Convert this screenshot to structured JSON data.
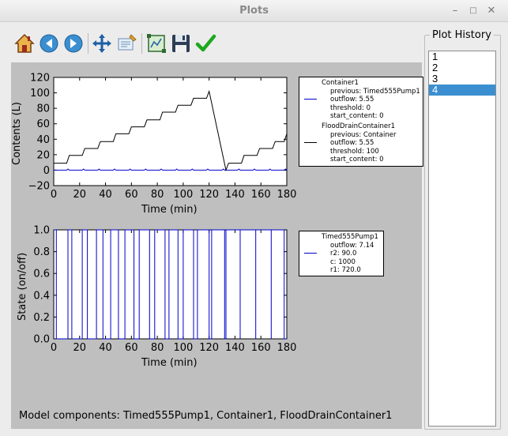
{
  "window": {
    "title": "Plots"
  },
  "toolbar": {
    "buttons": [
      {
        "icon": "home-icon",
        "name": "home-button"
      },
      {
        "icon": "back-arrow-icon",
        "name": "back-button"
      },
      {
        "icon": "forward-arrow-icon",
        "name": "forward-button"
      },
      {
        "icon": "pan-move-icon",
        "name": "pan-button"
      },
      {
        "icon": "zoom-icon",
        "name": "zoom-button"
      },
      {
        "icon": "subplots-config-icon",
        "name": "configure-subplots-button"
      },
      {
        "icon": "save-disk-icon",
        "name": "save-button"
      },
      {
        "icon": "checkmark-icon",
        "name": "apply-button"
      }
    ]
  },
  "chart_data": [
    {
      "type": "line",
      "xlabel": "Time (min)",
      "ylabel": "Contents (L)",
      "xlim": [
        0,
        180
      ],
      "ylim": [
        -20,
        120
      ],
      "xticks": [
        "0",
        "20",
        "40",
        "60",
        "80",
        "100",
        "120",
        "140",
        "160",
        "180"
      ],
      "yticks": [
        "−20",
        "0",
        "20",
        "40",
        "60",
        "80",
        "100",
        "120"
      ],
      "legend_placement": "outside-right",
      "series": [
        {
          "name": "Container1",
          "color": "#0000cc",
          "legend_lines": [
            "previous: Timed555Pump1",
            "outflow: 5.55",
            "threshold: 0",
            "start_content: 0"
          ],
          "points": [
            [
              0,
              0
            ],
            [
              10,
              0
            ],
            [
              11,
              1.5
            ],
            [
              12,
              0
            ],
            [
              22,
              0
            ],
            [
              23,
              1.5
            ],
            [
              24,
              0
            ],
            [
              34,
              0
            ],
            [
              35,
              1.5
            ],
            [
              36,
              0
            ],
            [
              46,
              0
            ],
            [
              47,
              1.5
            ],
            [
              48,
              0
            ],
            [
              58,
              0
            ],
            [
              59,
              1.5
            ],
            [
              60,
              0
            ],
            [
              70,
              0
            ],
            [
              71,
              1.5
            ],
            [
              72,
              0
            ],
            [
              82,
              0
            ],
            [
              83,
              1.5
            ],
            [
              84,
              0
            ],
            [
              94,
              0
            ],
            [
              95,
              1.5
            ],
            [
              96,
              0
            ],
            [
              106,
              0
            ],
            [
              107,
              1.5
            ],
            [
              108,
              0
            ],
            [
              118,
              0
            ],
            [
              119,
              1.5
            ],
            [
              120,
              0
            ],
            [
              130,
              0
            ],
            [
              131,
              1.5
            ],
            [
              132,
              0
            ],
            [
              142,
              0
            ],
            [
              143,
              1.5
            ],
            [
              144,
              0
            ],
            [
              154,
              0
            ],
            [
              155,
              1.5
            ],
            [
              156,
              0
            ],
            [
              166,
              0
            ],
            [
              167,
              1.5
            ],
            [
              168,
              0
            ],
            [
              178,
              0
            ],
            [
              179,
              1.5
            ],
            [
              180,
              0
            ]
          ]
        },
        {
          "name": "FloodDrainContainer1",
          "color": "#000000",
          "legend_lines": [
            "previous: Container",
            "outflow: 5.55",
            "threshold: 100",
            "start_content: 0"
          ],
          "points": [
            [
              0,
              9
            ],
            [
              10,
              9
            ],
            [
              12,
              19
            ],
            [
              22,
              19
            ],
            [
              24,
              28
            ],
            [
              34,
              28
            ],
            [
              36,
              37
            ],
            [
              46,
              37
            ],
            [
              48,
              47
            ],
            [
              58,
              47
            ],
            [
              60,
              56
            ],
            [
              70,
              56
            ],
            [
              72,
              65
            ],
            [
              82,
              65
            ],
            [
              84,
              75
            ],
            [
              94,
              75
            ],
            [
              96,
              84
            ],
            [
              106,
              84
            ],
            [
              108,
              93
            ],
            [
              118,
              93
            ],
            [
              120,
              102
            ],
            [
              133,
              0
            ],
            [
              135,
              9
            ],
            [
              145,
              9
            ],
            [
              147,
              19
            ],
            [
              157,
              19
            ],
            [
              159,
              28
            ],
            [
              169,
              28
            ],
            [
              171,
              37
            ],
            [
              178,
              37
            ],
            [
              180,
              47
            ]
          ]
        }
      ]
    },
    {
      "type": "line",
      "xlabel": "Time (min)",
      "ylabel": "State (on/off)",
      "xlim": [
        0,
        180
      ],
      "ylim": [
        0,
        1
      ],
      "xticks": [
        "0",
        "20",
        "40",
        "60",
        "80",
        "100",
        "120",
        "140",
        "160",
        "180"
      ],
      "yticks": [
        "0.0",
        "0.2",
        "0.4",
        "0.6",
        "0.8",
        "1.0"
      ],
      "legend_placement": "outside-right",
      "series": [
        {
          "name": "Timed555Pump1",
          "color": "#0000cc",
          "legend_lines": [
            "outflow: 7.14",
            "r2: 90.0",
            "c: 1000",
            "r1: 720.0"
          ],
          "on_intervals": [
            [
              0,
              2
            ],
            [
              11,
              14
            ],
            [
              22,
              26
            ],
            [
              33,
              38
            ],
            [
              44,
              50
            ],
            [
              55,
              62
            ],
            [
              66,
              74
            ],
            [
              78,
              86
            ],
            [
              89,
              96
            ],
            [
              100,
              108
            ],
            [
              111,
              120
            ],
            [
              122,
              132
            ],
            [
              133,
              144
            ],
            [
              144,
              156
            ],
            [
              156,
              168
            ],
            [
              168,
              178
            ]
          ]
        }
      ]
    }
  ],
  "footer": {
    "model_components": "Model components: Timed555Pump1, Container1, FloodDrainContainer1"
  },
  "history": {
    "title": "Plot History",
    "items": [
      "1",
      "2",
      "3",
      "4"
    ],
    "selected_index": 3
  }
}
